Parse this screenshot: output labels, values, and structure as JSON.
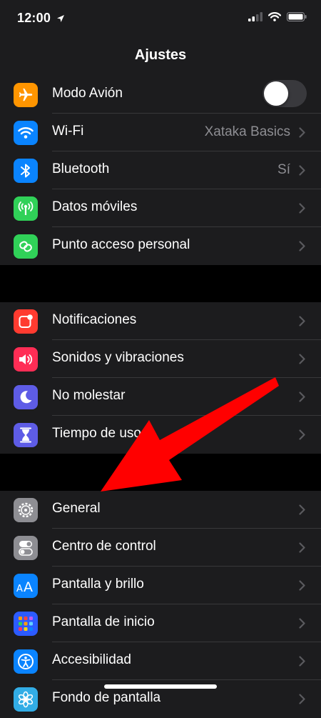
{
  "status_bar": {
    "time": "12:00"
  },
  "nav": {
    "title": "Ajustes"
  },
  "groups": [
    [
      {
        "label": "Modo Avión",
        "icon": "airplane-icon",
        "color": "#ff9500",
        "toggle": false
      },
      {
        "label": "Wi-Fi",
        "icon": "wifi-icon",
        "color": "#0a84ff",
        "value": "Xataka Basics"
      },
      {
        "label": "Bluetooth",
        "icon": "bluetooth-icon",
        "color": "#0a84ff",
        "value": "Sí"
      },
      {
        "label": "Datos móviles",
        "icon": "antenna-icon",
        "color": "#30d158"
      },
      {
        "label": "Punto acceso personal",
        "icon": "hotspot-icon",
        "color": "#30d158"
      }
    ],
    [
      {
        "label": "Notificaciones",
        "icon": "notifications-icon",
        "color": "#ff3b30"
      },
      {
        "label": "Sonidos y vibraciones",
        "icon": "speaker-icon",
        "color": "#ff2d55"
      },
      {
        "label": "No molestar",
        "icon": "moon-icon",
        "color": "#5e5ce6"
      },
      {
        "label": "Tiempo de uso",
        "icon": "hourglass-icon",
        "color": "#5e5ce6"
      }
    ],
    [
      {
        "label": "General",
        "icon": "gear-icon",
        "color": "#8e8e93"
      },
      {
        "label": "Centro de control",
        "icon": "toggles-icon",
        "color": "#8e8e93"
      },
      {
        "label": "Pantalla y brillo",
        "icon": "text-size-icon",
        "color": "#0a84ff"
      },
      {
        "label": "Pantalla de inicio",
        "icon": "app-grid-icon",
        "color": "#2c5bff"
      },
      {
        "label": "Accesibilidad",
        "icon": "accessibility-icon",
        "color": "#0a84ff"
      },
      {
        "label": "Fondo de pantalla",
        "icon": "flower-icon",
        "color": "#32ade6"
      }
    ]
  ],
  "annotation": {
    "color": "#ff0000",
    "points_to": "General"
  }
}
